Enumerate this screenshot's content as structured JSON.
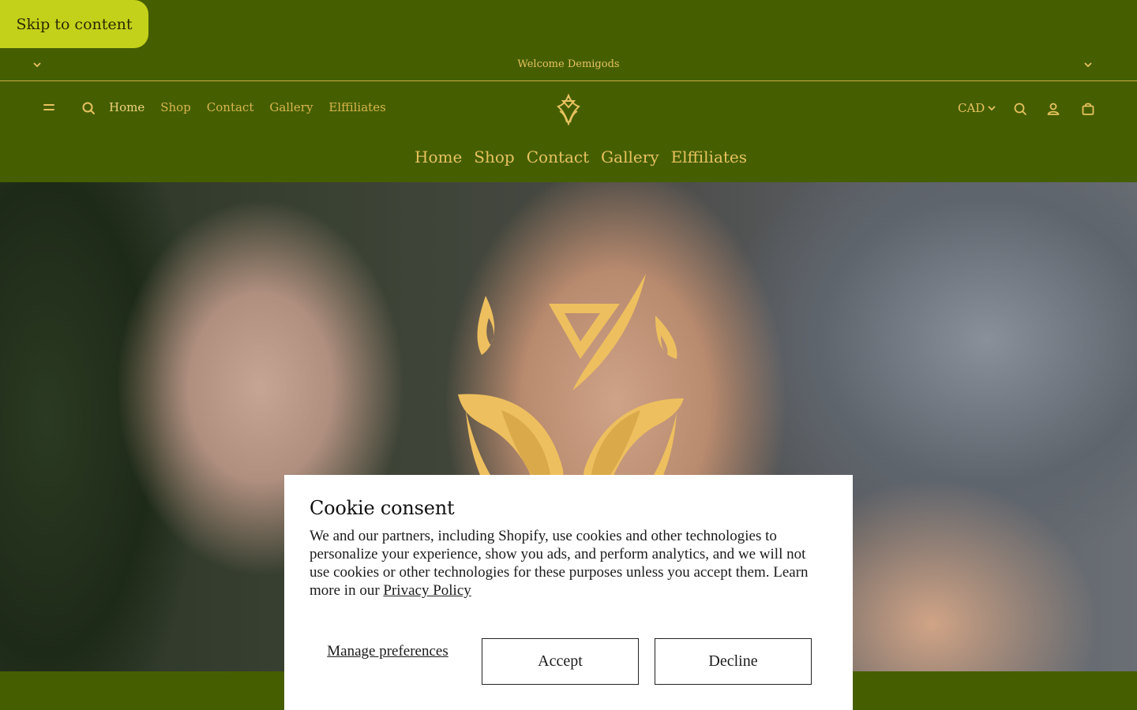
{
  "skip_link": "Skip to content",
  "announcement": {
    "text": "Welcome Demigods"
  },
  "header": {
    "nav": [
      "Home",
      "Shop",
      "Contact",
      "Gallery",
      "Elffiliates"
    ],
    "currency": "CAD"
  },
  "main_nav": [
    "Home",
    "Shop",
    "Contact",
    "Gallery",
    "Elffiliates"
  ],
  "colors": {
    "background": "#455f00",
    "accent": "#e8c25e",
    "skip_bg": "#c4d11a"
  },
  "cookie": {
    "title": "Cookie consent",
    "body": "We and our partners, including Shopify, use cookies and other technologies to personalize your experience, show you ads, and perform analytics, and we will not use cookies or other technologies for these purposes unless you accept them. Learn more in our ",
    "privacy_link": "Privacy Policy",
    "manage_label": "Manage preferences",
    "accept_label": "Accept",
    "decline_label": "Decline"
  }
}
